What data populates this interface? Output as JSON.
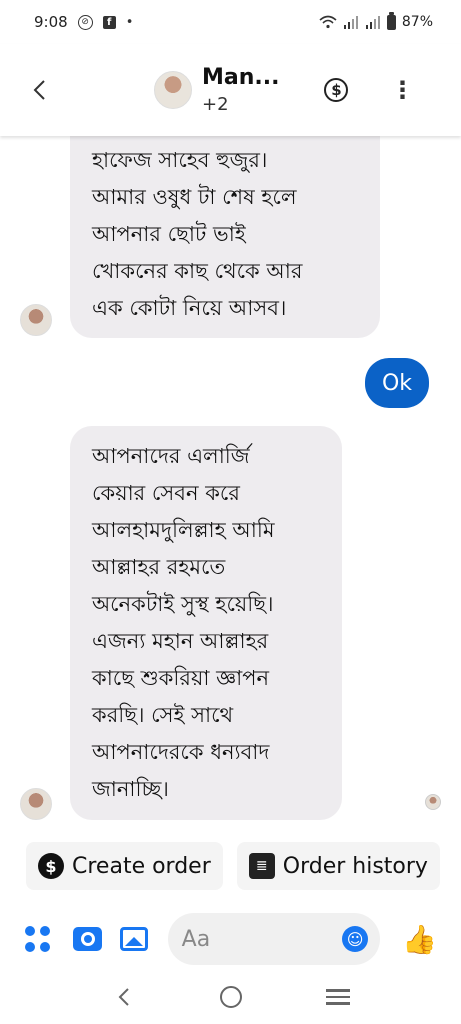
{
  "status_bar": {
    "time": "9:08",
    "battery": "87%"
  },
  "header": {
    "name": "Man...",
    "sub": "+2"
  },
  "chat": {
    "received_1": [
      "হাফেজ সাহেব হুজুর।",
      "আমার ওষুধ টা শেষ হলে",
      "আপনার ছোট ভাই",
      "খোকনের কাছ থেকে আর",
      "এক কোটা নিয়ে আসব।"
    ],
    "sent_1": "Ok",
    "received_2": [
      "আপনাদের এলার্জি",
      "কেয়ার সেবন করে",
      "আলহামদুলিল্লাহ আমি",
      "আল্লাহর রহমতে",
      "অনেকটাই সুস্থ হয়েছি।",
      "এজন্য মহান আল্লাহর",
      "কাছে শুকরিয়া জ্ঞাপন",
      "করছি। সেই সাথে",
      "আপনাদেরকে ধন্যবাদ",
      "জানাচ্ছি।"
    ]
  },
  "quick_actions": {
    "create_order": "Create order",
    "order_history": "Order history"
  },
  "composer": {
    "placeholder": "Aa"
  },
  "colors": {
    "accent": "#1877f2",
    "sent_bubble": "#0b62c7",
    "received_bubble": "#eeecef"
  },
  "icons": [
    "dnd-icon",
    "facebook-icon",
    "wifi-icon",
    "signal-icon",
    "battery-icon",
    "back-icon",
    "dollar-icon",
    "more-icon",
    "apps-icon",
    "camera-icon",
    "image-icon",
    "emoji-icon",
    "like-icon",
    "nav-back-icon",
    "nav-home-icon",
    "nav-recents-icon"
  ]
}
